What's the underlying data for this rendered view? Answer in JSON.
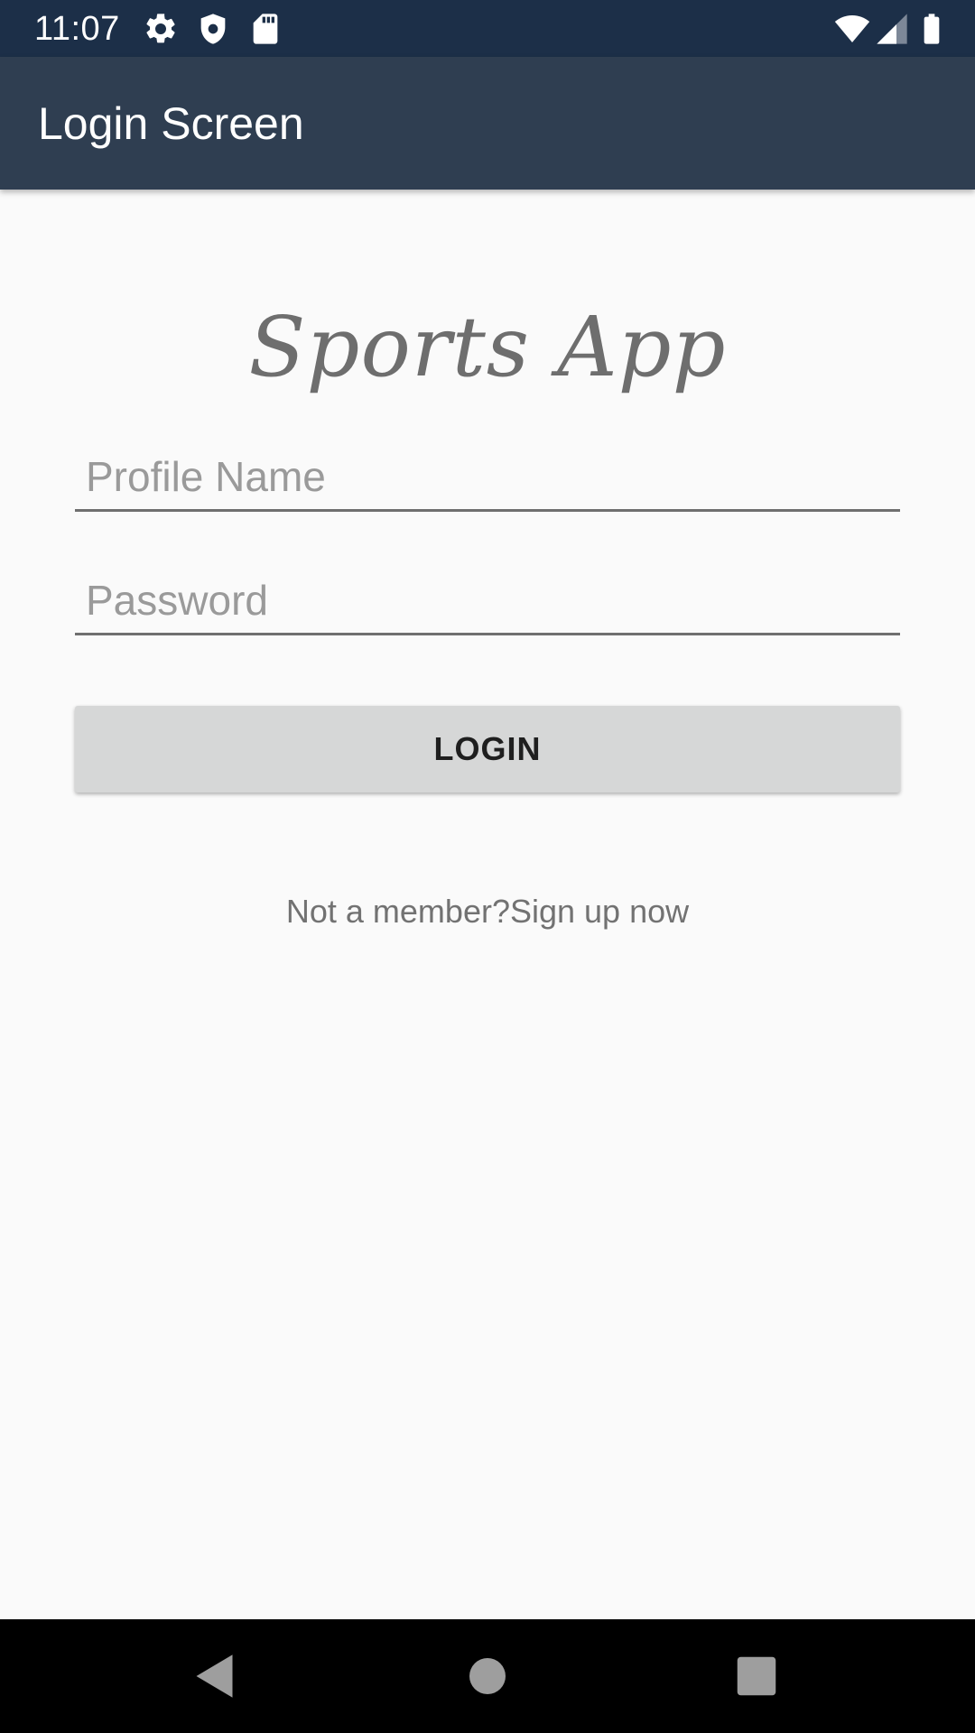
{
  "status_bar": {
    "time": "11:07",
    "left_icons": [
      "gear-icon",
      "shield-icon",
      "sd-card-icon"
    ],
    "right_icons": [
      "wifi-icon",
      "signal-icon",
      "battery-icon"
    ],
    "background": "#1c2f48"
  },
  "app_bar": {
    "title": "Login Screen",
    "background": "#2f3e51"
  },
  "logo_text": "Sports App",
  "form": {
    "profile_name": {
      "placeholder": "Profile Name",
      "value": ""
    },
    "password": {
      "placeholder": "Password",
      "value": ""
    },
    "login_label": "LOGIN",
    "signup_text": "Not a member?Sign up now"
  },
  "nav_bar": {
    "buttons": [
      "back-icon",
      "home-icon",
      "recents-icon"
    ]
  }
}
